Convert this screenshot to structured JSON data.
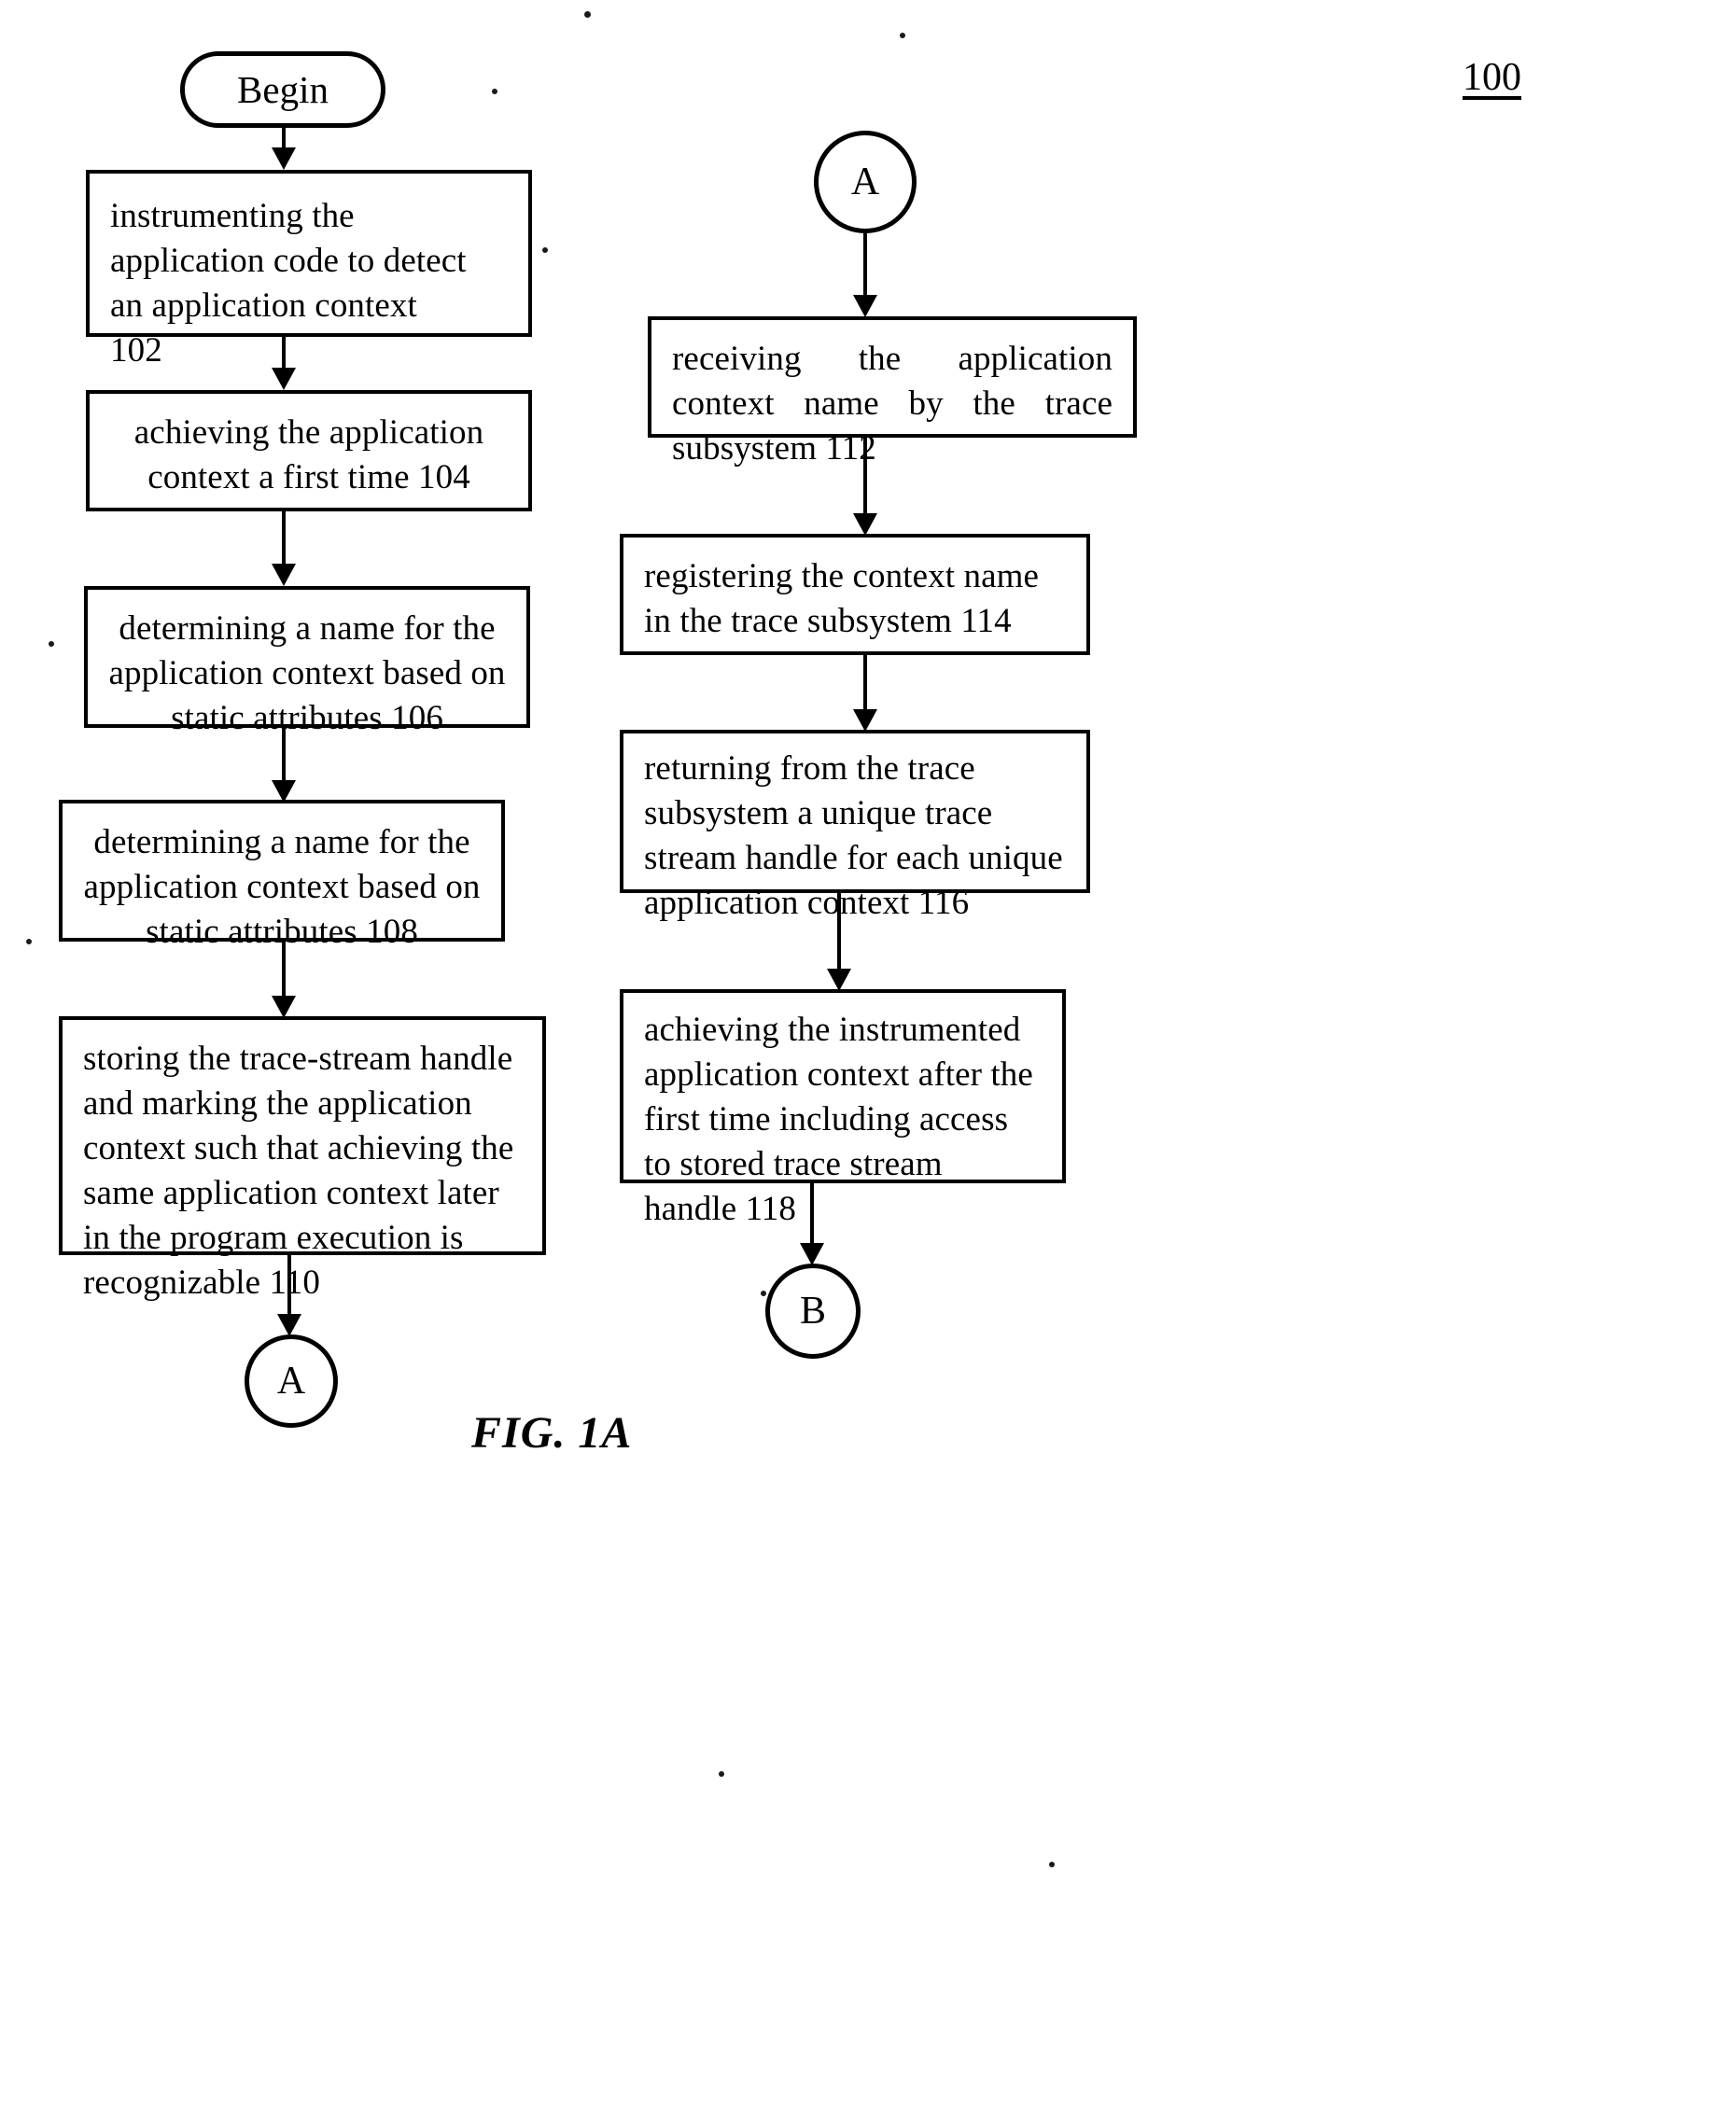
{
  "figure": {
    "label": "FIG. 1A",
    "reference_numeral": "100"
  },
  "left_column": {
    "start": {
      "label": "Begin"
    },
    "steps": [
      {
        "id": "102",
        "text": "instrumenting the application code to detect an application context\n102",
        "align": "left"
      },
      {
        "id": "104",
        "text": "achieving the application context a first time 104",
        "align": "center"
      },
      {
        "id": "106",
        "text": "determining a name for the application context based on static attributes 106",
        "align": "center"
      },
      {
        "id": "108",
        "text": "determining a name for the application context based on static attributes 108",
        "align": "center"
      },
      {
        "id": "110",
        "text": "storing the trace-stream handle and marking the application context such that achieving the same application context later in the program execution is recognizable 110",
        "align": "left"
      }
    ],
    "end_connector": {
      "label": "A"
    }
  },
  "right_column": {
    "start_connector": {
      "label": "A"
    },
    "steps": [
      {
        "id": "112",
        "text": "receiving the application context name by the trace subsystem 112",
        "align": "justify"
      },
      {
        "id": "114",
        "text": "registering the context name in the trace subsystem 114",
        "align": "left"
      },
      {
        "id": "116",
        "text": "returning from the trace subsystem a unique trace stream handle for each unique application context     116",
        "align": "left"
      },
      {
        "id": "118",
        "text": "achieving the instrumented application context after the first time including access to stored trace stream handle 118",
        "align": "left"
      }
    ],
    "end_connector": {
      "label": "B"
    }
  },
  "colors": {
    "ink": "#000000",
    "paper": "#ffffff"
  }
}
